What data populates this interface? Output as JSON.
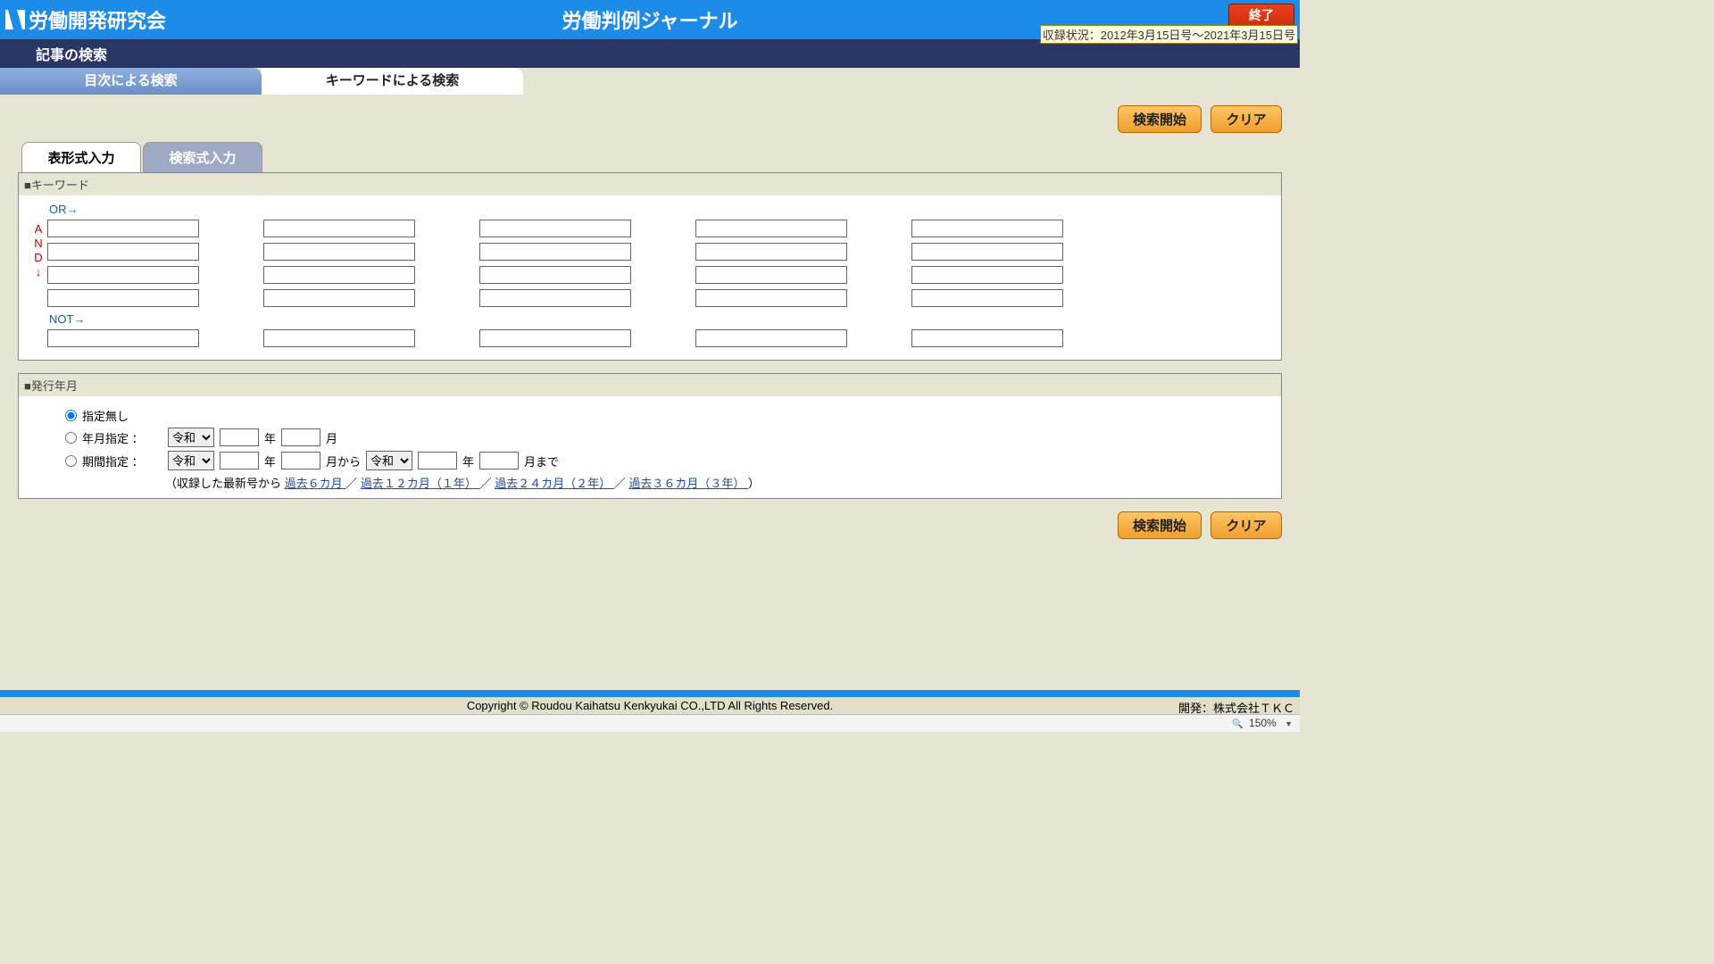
{
  "header": {
    "logo_text": "労働開発研究会",
    "app_title": "労働判例ジャーナル",
    "exit_label": "終了",
    "status_text": "収録状況：2012年3月15日号～2021年3月15日号"
  },
  "subheader": "記事の検索",
  "main_tabs": {
    "inactive": "目次による検索",
    "active": "キーワードによる検索"
  },
  "buttons": {
    "search": "検索開始",
    "clear": "クリア"
  },
  "sub_tabs": {
    "active": "表形式入力",
    "inactive": "検索式入力"
  },
  "keyword_panel": {
    "title": "■キーワード",
    "or_label": "OR→",
    "and_label": [
      "A",
      "N",
      "D",
      "↓"
    ],
    "not_label": "NOT→"
  },
  "date_panel": {
    "title": "■発行年月",
    "opt_none": "指定無し",
    "opt_ym": "年月指定  ：",
    "opt_range": "期間指定  ：",
    "era": "令和",
    "year_label": "年",
    "month_label": "月",
    "month_from": "月から",
    "month_to": "月まで",
    "links_prefix": "（収録した最新号から ",
    "link6": "過去６カ月 ",
    "link12": "過去１２カ月（１年） ",
    "link24": "過去２４カ月（２年） ",
    "link36": "過去３６カ月（３年） ",
    "sep": "／ ",
    "links_suffix": "）"
  },
  "footer": {
    "copyright": "Copyright © Roudou Kaihatsu Kenkyukai CO.,LTD All Rights Reserved.",
    "developer": "開発：株式会社ＴＫＣ"
  },
  "zoom": "150%"
}
